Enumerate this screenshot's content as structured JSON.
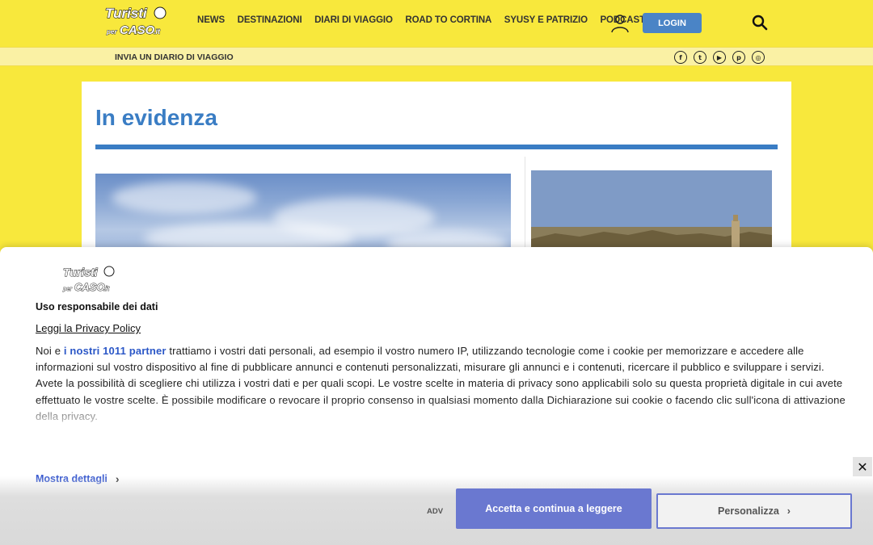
{
  "header": {
    "logo_text": "Turisti per CASO.it",
    "nav": [
      "NEWS",
      "DESTINAZIONI",
      "DIARI DI VIAGGIO",
      "ROAD TO CORTINA",
      "SYUSY E PATRIZIO",
      "PODCAST"
    ],
    "login_label": "LOGIN"
  },
  "subbar": {
    "link": "INVIA UN DIARIO DI VIAGGIO",
    "social": [
      {
        "icon": "facebook-icon",
        "glyph": "f"
      },
      {
        "icon": "twitter-icon",
        "glyph": "t"
      },
      {
        "icon": "youtube-icon",
        "glyph": "▶"
      },
      {
        "icon": "pinterest-icon",
        "glyph": "p"
      },
      {
        "icon": "instagram-icon",
        "glyph": "◎"
      }
    ]
  },
  "main": {
    "title": "In evidenza"
  },
  "consent": {
    "heading": "Uso responsabile dei dati",
    "privacy_link": "Leggi la Privacy Policy",
    "text_before": "Noi e ",
    "partners_link": "i nostri 1011 partner",
    "text_after": " trattiamo i vostri dati personali, ad esempio il vostro numero IP, utilizzando tecnologie come i cookie per memorizzare e accedere alle informazioni sul vostro dispositivo al fine di pubblicare annunci e contenuti personalizzati, misurare gli annunci e i contenuti, ricercare il pubblico e sviluppare i servizi. Avete la possibilità di scegliere chi utilizza i vostri dati e per quali scopi. Le vostre scelte in materia di privacy sono applicabili solo su questa proprietà digitale in cui avete effettuato le vostre scelte. È possibile modificare o revocare il proprio consenso in qualsiasi momento dalla Dichiarazione sui cookie o facendo clic sull'icona di attivazione della privacy.",
    "details_label": "Mostra dettagli",
    "adv_label": "ADV",
    "accept_label": "Accetta e continua a leggere",
    "customize_label": "Personalizza",
    "close_glyph": "✕"
  },
  "colors": {
    "brand_yellow": "#f8e83c",
    "accent_blue": "#3a7dc4",
    "login_blue": "#4a84c6",
    "consent_button": "#6a78d0",
    "partner_link": "#2b57c7"
  }
}
